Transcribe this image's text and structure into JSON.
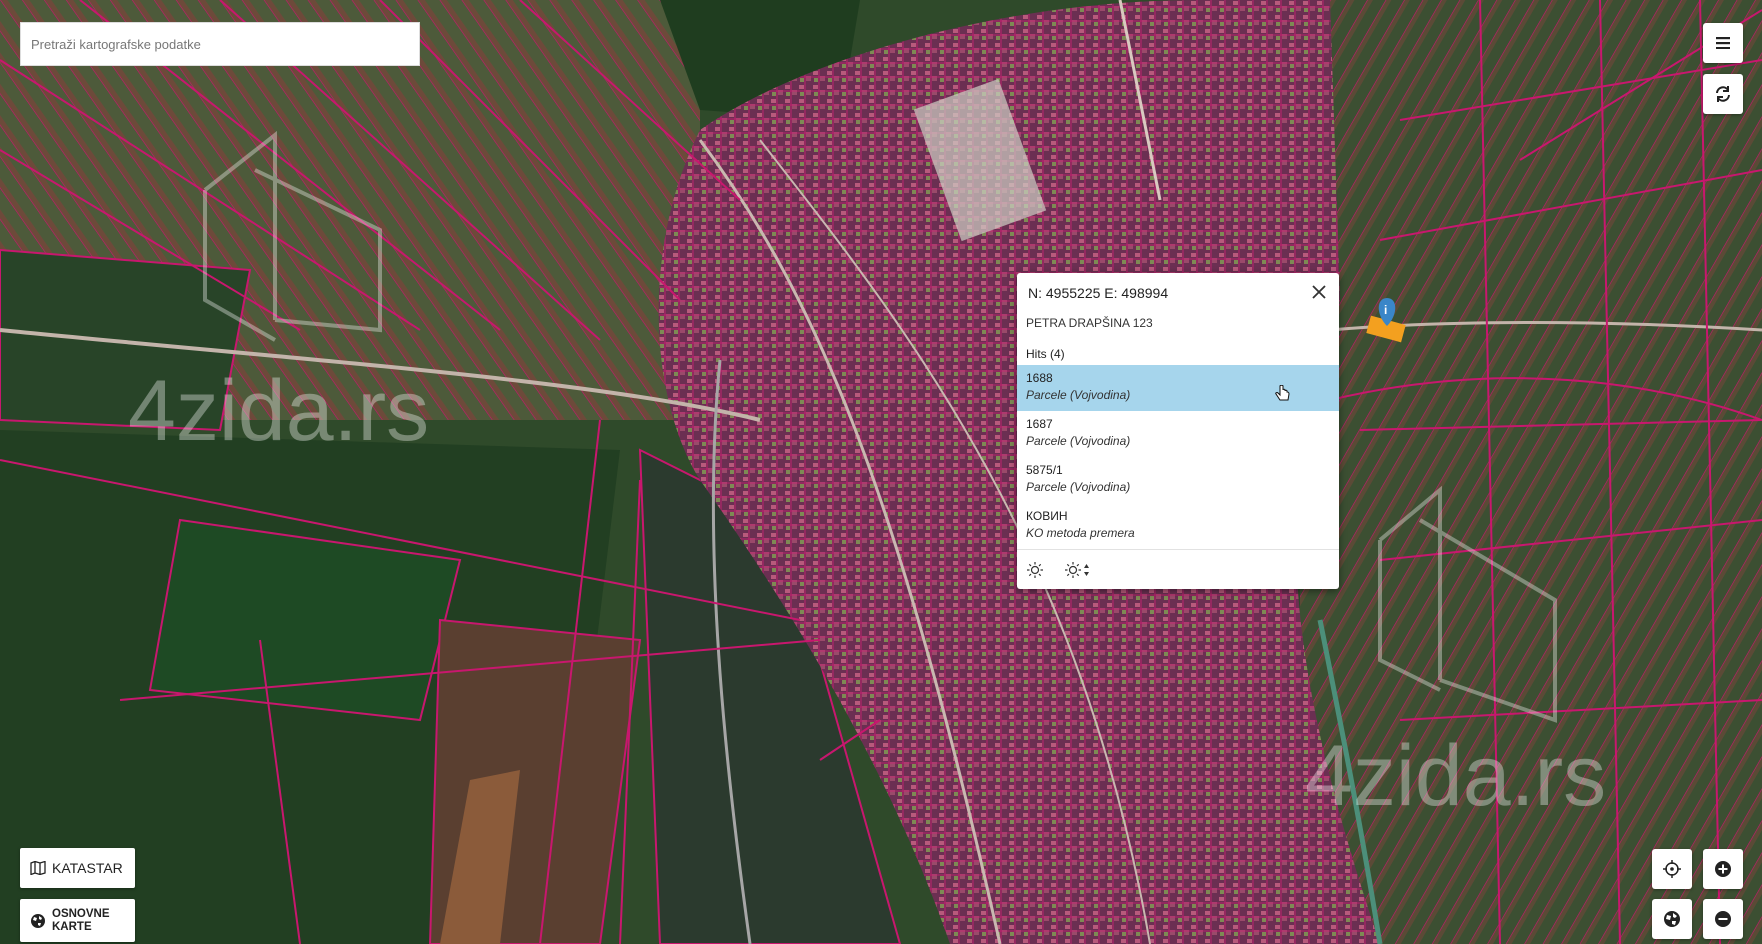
{
  "search": {
    "placeholder": "Pretraži kartografske podatke"
  },
  "toolbar": {
    "menu_icon": "hamburger-menu-icon",
    "refresh_icon": "refresh-icon"
  },
  "popup": {
    "coords": "N: 4955225 E: 498994",
    "address": "PETRA DRAPŠINA 123",
    "hits_label": "Hits (4)",
    "items": [
      {
        "title": "1688",
        "subtitle": "Parcele (Vojvodina)",
        "selected": true
      },
      {
        "title": "1687",
        "subtitle": "Parcele (Vojvodina)",
        "selected": false
      },
      {
        "title": "5875/1",
        "subtitle": "Parcele (Vojvodina)",
        "selected": false
      },
      {
        "title": "КОВИН",
        "subtitle": "KO metoda premera",
        "selected": false
      }
    ],
    "footer_icons": [
      "brightness-icon",
      "brightness-adjust-icon"
    ]
  },
  "watermark": "4zida.rs",
  "buttons": {
    "katastar": "KATASTAR",
    "osnovne_line1": "OSNOVNE",
    "osnovne_line2": "KARTE"
  },
  "colors": {
    "parcel_line": "#c8176e",
    "selection": "#a6d5ec",
    "marker": "#3a86c8",
    "marker_plot": "#f3a01f"
  }
}
